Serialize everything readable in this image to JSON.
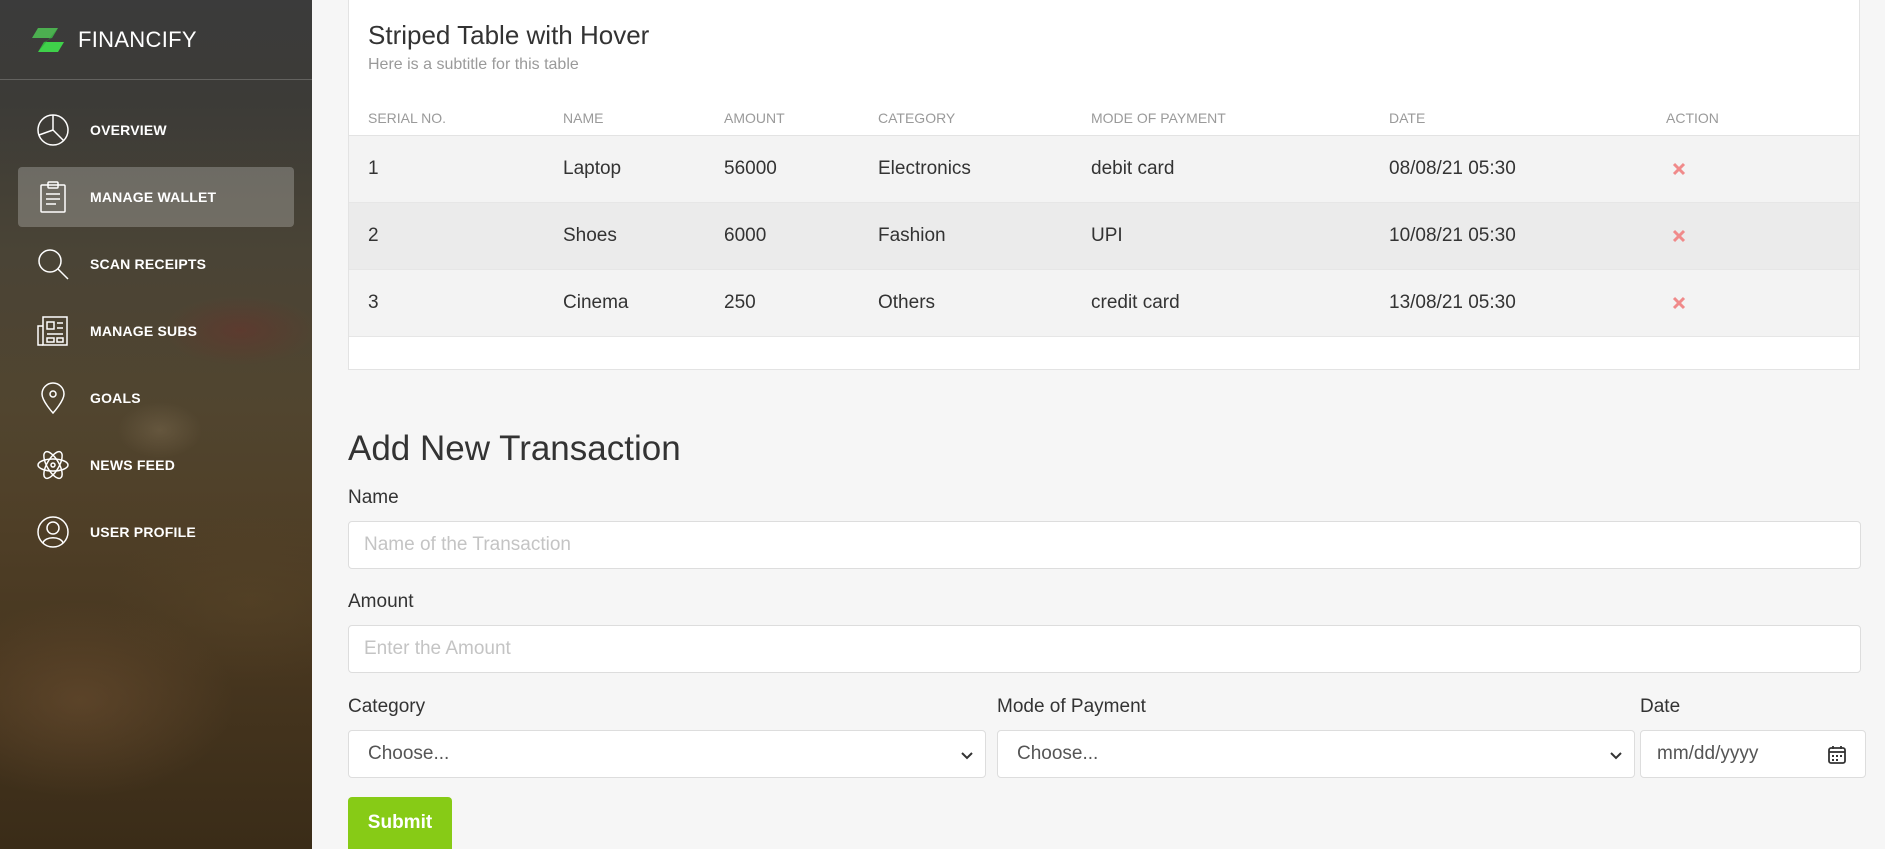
{
  "brand": {
    "name": "FINANCIFY",
    "accent": "#4caf50"
  },
  "sidebar": {
    "items": [
      {
        "label": "OVERVIEW",
        "icon": "pie-chart-icon",
        "active": false
      },
      {
        "label": "MANAGE WALLET",
        "icon": "clipboard-icon",
        "active": true
      },
      {
        "label": "SCAN RECEIPTS",
        "icon": "search-icon",
        "active": false
      },
      {
        "label": "MANAGE SUBS",
        "icon": "newspaper-icon",
        "active": false
      },
      {
        "label": "GOALS",
        "icon": "map-pin-icon",
        "active": false
      },
      {
        "label": "NEWS FEED",
        "icon": "atom-icon",
        "active": false
      },
      {
        "label": "USER PROFILE",
        "icon": "user-circle-icon",
        "active": false
      }
    ]
  },
  "table_card": {
    "title": "Striped Table with Hover",
    "subtitle": "Here is a subtitle for this table",
    "columns": [
      "SERIAL NO.",
      "NAME",
      "AMOUNT",
      "CATEGORY",
      "MODE OF PAYMENT",
      "DATE",
      "ACTION"
    ],
    "rows": [
      {
        "serial": "1",
        "name": "Laptop",
        "amount": "56000",
        "category": "Electronics",
        "mode": "debit card",
        "date": "08/08/21 05:30"
      },
      {
        "serial": "2",
        "name": "Shoes",
        "amount": "6000",
        "category": "Fashion",
        "mode": "UPI",
        "date": "10/08/21 05:30"
      },
      {
        "serial": "3",
        "name": "Cinema",
        "amount": "250",
        "category": "Others",
        "mode": "credit card",
        "date": "13/08/21 05:30"
      }
    ]
  },
  "form": {
    "title": "Add New Transaction",
    "name_label": "Name",
    "name_placeholder": "Name of the Transaction",
    "amount_label": "Amount",
    "amount_placeholder": "Enter the Amount",
    "category_label": "Category",
    "category_value": "Choose...",
    "mode_label": "Mode of Payment",
    "mode_value": "Choose...",
    "date_label": "Date",
    "date_placeholder": "mm/dd/yyyy",
    "submit_label": "Submit",
    "submit_color": "#87cb16"
  }
}
